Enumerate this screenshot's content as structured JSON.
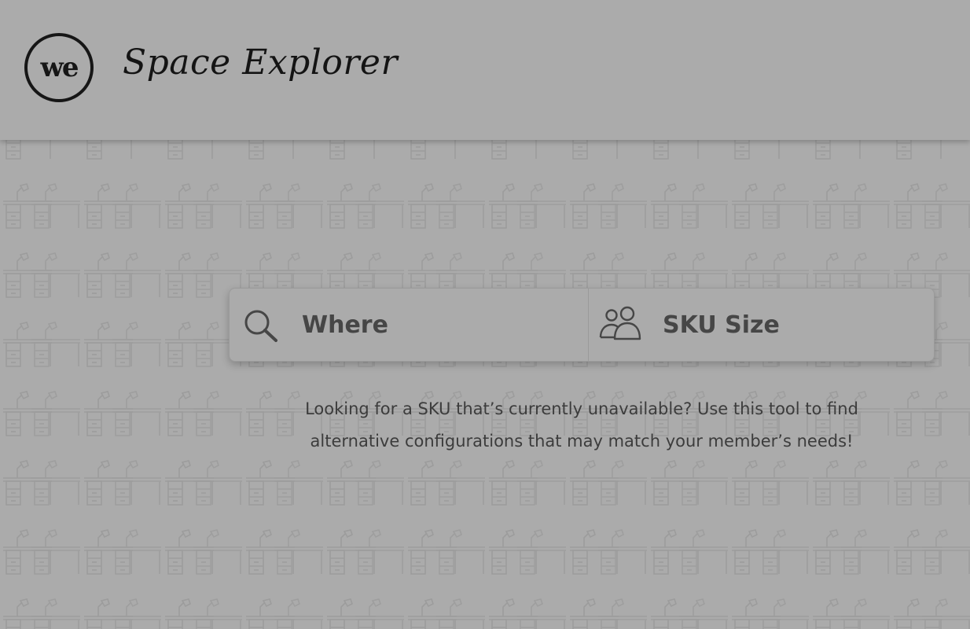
{
  "header": {
    "logo_text": "we",
    "app_title": "Space Explorer"
  },
  "search": {
    "where_label": "Where",
    "where_icon": "search-icon",
    "sku_label": "SKU Size",
    "sku_icon": "people-icon"
  },
  "tagline": {
    "line1": "Looking for a SKU that’s currently unavailable? Use this tool to find",
    "line2": "alternative configurations that may match your member’s needs!"
  },
  "colors": {
    "background": "#ababab",
    "text_dark": "#141414",
    "text_label": "#464646",
    "pattern_stroke": "#9c9c9c"
  }
}
